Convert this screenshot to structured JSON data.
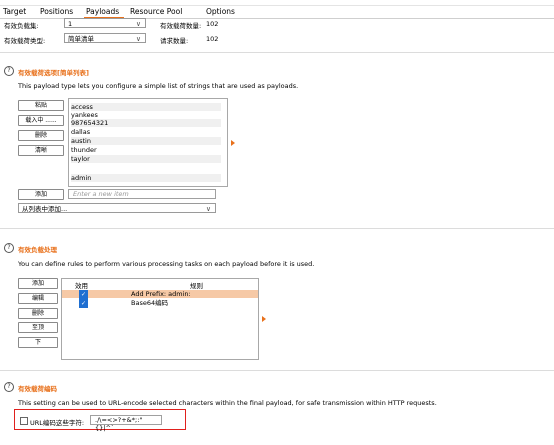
{
  "tabs": [
    "Target",
    "Positions",
    "Payloads",
    "Resource Pool",
    "Options"
  ],
  "active_tab": "Payloads",
  "accent_color": "#e8711c",
  "payload_sets": {
    "set_label": "有效负载集:",
    "set_value": "1",
    "count_label": "有效载荷数量:",
    "count_value": "102",
    "type_label": "有效载荷类型:",
    "type_value": "简单清单",
    "request_label": "请求数量:",
    "request_value": "102"
  },
  "options": {
    "title": "有效载荷选项[简单列表]",
    "description": "This payload type lets you configure a simple list of strings that are used as payloads.",
    "buttons": [
      "粘贴",
      "载入中 ......",
      "删除",
      "清晰"
    ],
    "list_items": [
      "access",
      "yankees",
      "987654321",
      "dallas",
      "austin",
      "thunder",
      "taylor",
      "",
      "admin"
    ],
    "add_button": "添加",
    "add_placeholder": "Enter a new item",
    "add_from_list": "从列表中添加..."
  },
  "processing": {
    "title": "有效负载处理",
    "description": "You can define rules to perform various processing tasks on each payload before it is used.",
    "buttons": [
      "添加",
      "编辑",
      "删除",
      "至顶",
      "下"
    ],
    "col_enabled": "效用",
    "col_rule": "规则",
    "rules": [
      {
        "enabled": true,
        "rule": "Add Prefix: admin:"
      },
      {
        "enabled": true,
        "rule": "Base64编码"
      }
    ]
  },
  "encoding": {
    "title": "有效载荷编码",
    "description": "This setting can be used to URL-encode selected characters within the final payload, for safe transmission within HTTP requests.",
    "checkbox_label": "URL编码这些字符:",
    "chars_value": "./\\=<>?+&*;:\"{}|^`"
  }
}
